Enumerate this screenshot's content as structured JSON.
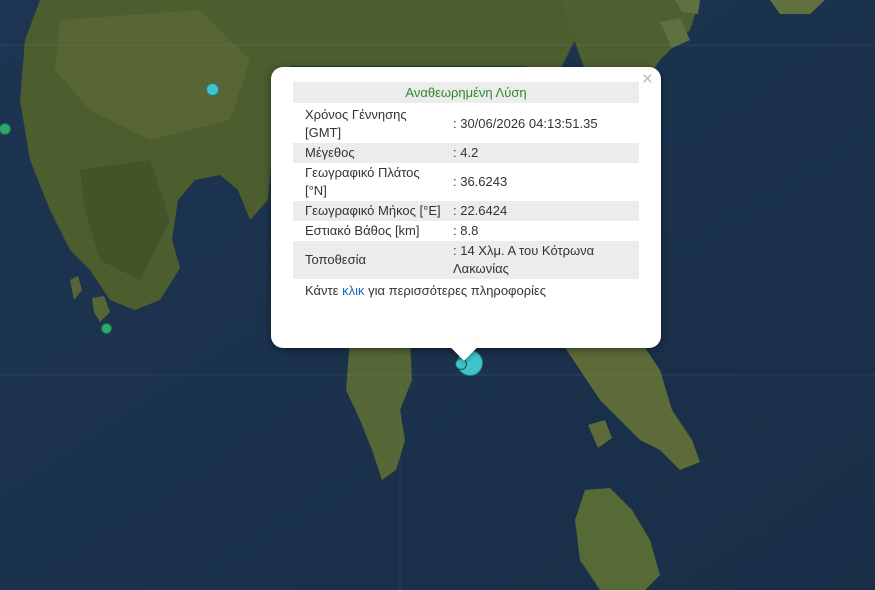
{
  "popup": {
    "title": "Αναθεωρημένη Λύση",
    "close_symbol": "×",
    "rows": [
      {
        "label": "Χρόνος Γέννησης [GMT]",
        "value": ": 30/06/2026 04:13:51.35"
      },
      {
        "label": "Μέγεθος",
        "value": ": 4.2"
      },
      {
        "label": "Γεωγραφικό Πλάτος [°N]",
        "value": ": 36.6243"
      },
      {
        "label": "Γεωγραφικό Μήκος [°E]",
        "value": ": 22.6424"
      },
      {
        "label": "Εστιακό Βάθος [km]",
        "value": ": 8.8"
      },
      {
        "label": "Τοποθεσία",
        "value": ": 14 Χλμ. Α του Κότρωνα Λακωνίας"
      }
    ],
    "footer": {
      "before": "Κάντε ",
      "link": "κλικ",
      "after": " για περισσότερες πληροφορίες"
    }
  },
  "map": {
    "sea_color": "#1b3350",
    "land_color": "#4a5a2c",
    "marker_color": "#3fc4cc",
    "epicenter_marker": {
      "icon": "epicenter-marker-icon"
    }
  }
}
